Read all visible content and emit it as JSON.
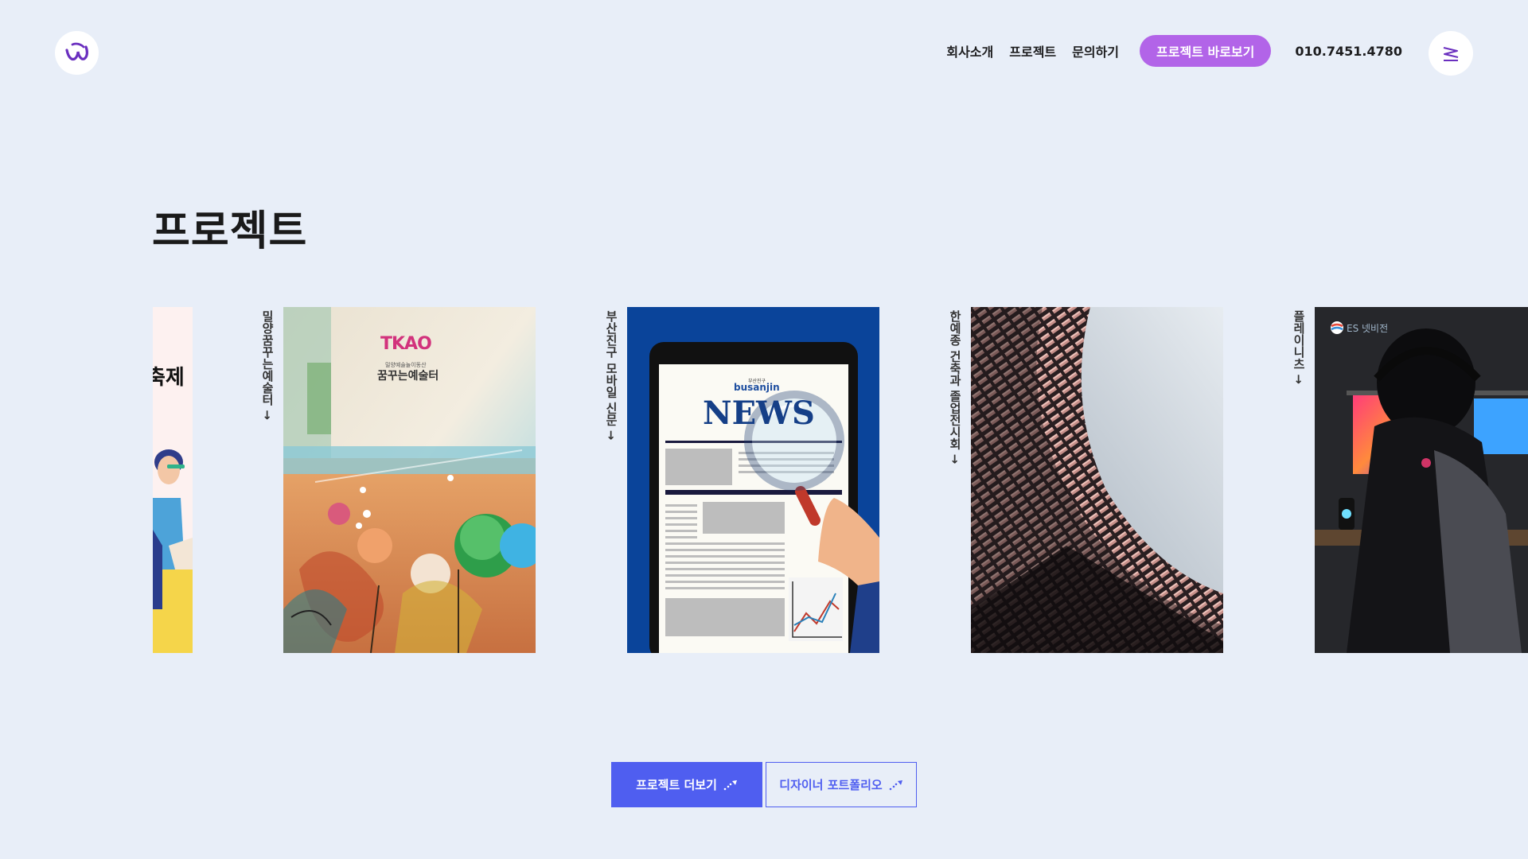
{
  "header": {
    "nav": [
      "회사소개",
      "프로젝트",
      "문의하기"
    ],
    "cta_label": "프로젝트 바로보기",
    "phone": "010.7451.4780"
  },
  "main": {
    "title": "프로젝트",
    "slides": [
      {
        "caption": "",
        "thumb_text": "축제"
      },
      {
        "caption": "밀양꿈꾸는예술터 →",
        "thumb_title": "꿈꾸는예술터",
        "thumb_logo": "TKAO",
        "thumb_sub": "밀양예술놀이동산"
      },
      {
        "caption": "부산진구 모바일 신문 →",
        "thumb_title": "NEWS",
        "thumb_brand": "busanjin",
        "thumb_sub": "부산진구"
      },
      {
        "caption": "한예종 건축과 졸업전시회 →"
      },
      {
        "caption": "플레이니츠 →",
        "thumb_brand": "ES 넷비전"
      }
    ]
  },
  "buttons": {
    "more_label": "프로젝트 더보기",
    "portfolio_label": "디자이너 포트폴리오"
  },
  "colors": {
    "background": "#e8eef8",
    "accent_purple": "#b264e8",
    "accent_blue": "#4f5ef0"
  }
}
